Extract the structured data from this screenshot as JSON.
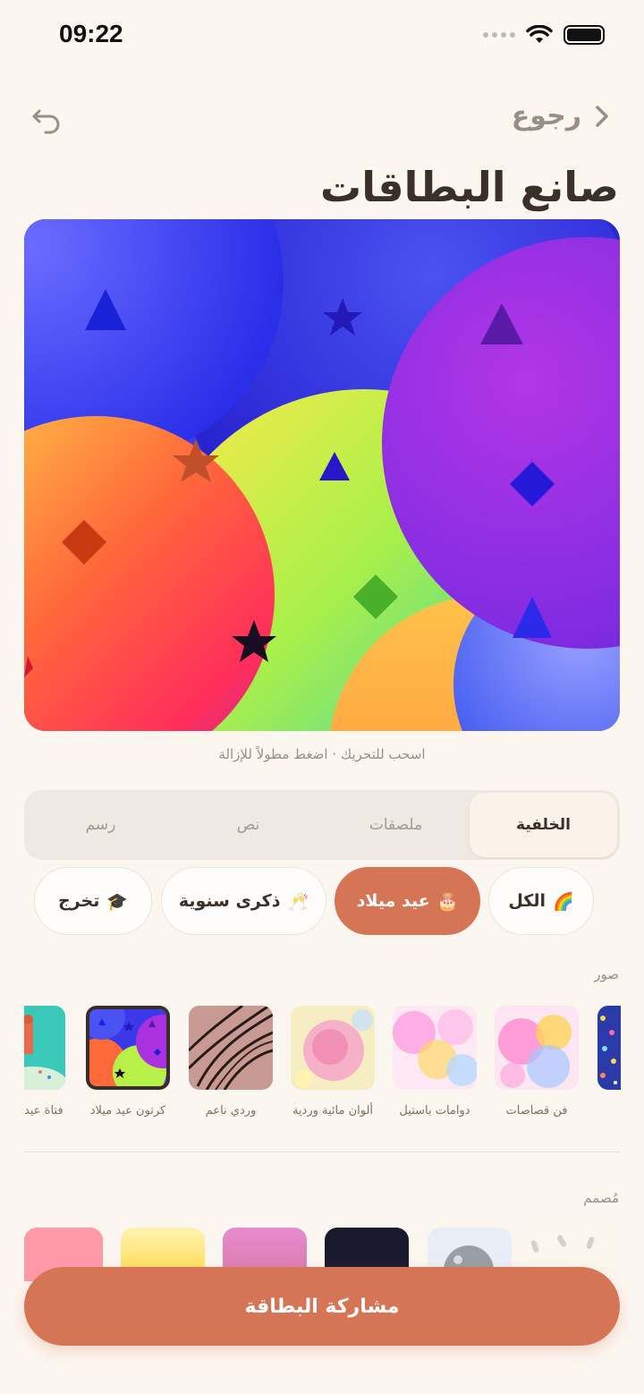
{
  "status": {
    "time": "09:22"
  },
  "nav": {
    "back_label": "رجوع"
  },
  "title": "صانع البطاقات",
  "canvas": {
    "hint": "اسحب للتحريك · اضغط مطولاً للإزالة"
  },
  "tabs": [
    {
      "label": "الخلفية",
      "active": true
    },
    {
      "label": "ملصقات",
      "active": false
    },
    {
      "label": "نص",
      "active": false
    },
    {
      "label": "رسم",
      "active": false
    }
  ],
  "chips": [
    {
      "label": "الكل",
      "emoji": "🌈",
      "active": false
    },
    {
      "label": "عيد ميلاد",
      "emoji": "🎂",
      "active": true
    },
    {
      "label": "ذكرى سنوية",
      "emoji": "🥂",
      "active": false
    },
    {
      "label": "تخرج",
      "emoji": "🎓",
      "active": false
    }
  ],
  "photos_section": {
    "label": "صور",
    "items": [
      {
        "caption": "فن قصاصات"
      },
      {
        "caption": "دوامات باستيل"
      },
      {
        "caption": "ألوان مائية وردية"
      },
      {
        "caption": "وردي ناعم"
      },
      {
        "caption": "كرتون عيد ميلاد",
        "selected": true
      },
      {
        "caption": "فتاة عيد"
      }
    ]
  },
  "designer_section": {
    "label": "مُصمم"
  },
  "share_button": {
    "label": "مشاركة البطاقة"
  },
  "colors": {
    "accent": "#d67555",
    "background": "#fcf6f0",
    "text": "#3b2f2a"
  }
}
